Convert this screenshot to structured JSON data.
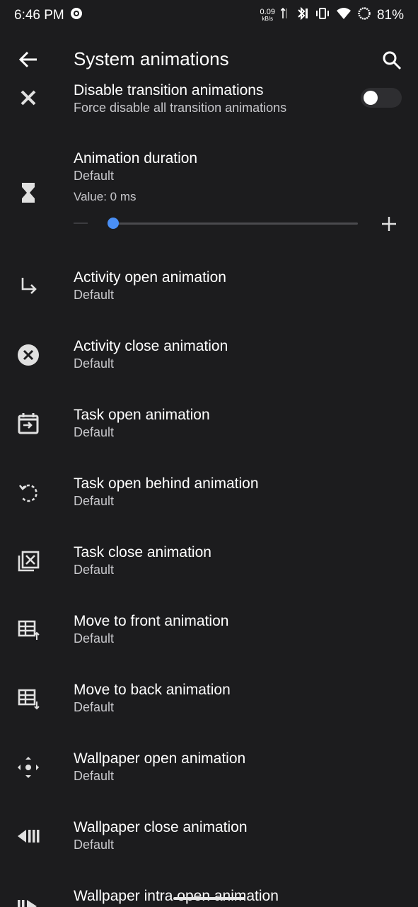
{
  "status_bar": {
    "time": "6:46 PM",
    "net_rate": "0.09",
    "net_unit": "kB/s",
    "battery": "81%"
  },
  "app_bar": {
    "title": "System animations"
  },
  "items": [
    {
      "title": "Disable transition animations",
      "subtitle": "Force disable all transition animations",
      "icon": "close-x-icon"
    },
    {
      "title": "Animation duration",
      "subtitle": "Default",
      "value_text": "Value: 0 ms",
      "slider_value_fraction": 0.0,
      "icon": "hourglass-icon"
    },
    {
      "title": "Activity open animation",
      "subtitle": "Default",
      "icon": "subdirectory-arrow-icon"
    },
    {
      "title": "Activity close animation",
      "subtitle": "Default",
      "icon": "cancel-circle-icon"
    },
    {
      "title": "Task open animation",
      "subtitle": "Default",
      "icon": "calendar-enter-icon"
    },
    {
      "title": "Task open behind animation",
      "subtitle": "Default",
      "icon": "rotate-left-icon"
    },
    {
      "title": "Task close animation",
      "subtitle": "Default",
      "icon": "stacked-close-icon"
    },
    {
      "title": "Move to front animation",
      "subtitle": "Default",
      "icon": "table-up-icon"
    },
    {
      "title": "Move to back animation",
      "subtitle": "Default",
      "icon": "table-down-icon"
    },
    {
      "title": "Wallpaper open animation",
      "subtitle": "Default",
      "icon": "move-arrows-icon"
    },
    {
      "title": "Wallpaper close animation",
      "subtitle": "Default",
      "icon": "skip-back-icon"
    },
    {
      "title": "Wallpaper intra open animation",
      "subtitle": "",
      "icon": "skip-forward-icon"
    }
  ],
  "toggle_state": "off",
  "colors": {
    "background": "#1c1c1e",
    "accent": "#4a8ff5"
  }
}
